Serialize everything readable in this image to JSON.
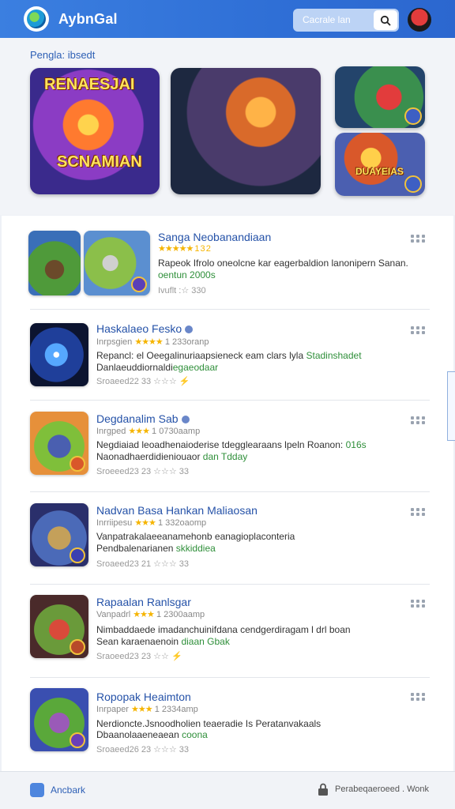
{
  "header": {
    "app_title": "AybnGal",
    "search_placeholder": "Cacrale lan",
    "logo_icon": "globe-logo-icon",
    "search_icon": "search-icon",
    "avatar_icon": "avatar-icon"
  },
  "featured": {
    "title": "Pengla: ibsedt",
    "tiles": [
      {
        "text_top": "RENAESJAI",
        "text_bottom": "SCNAMIAN"
      },
      {
        "text_top": "",
        "text_bottom": ""
      },
      {
        "text_top": "",
        "text_bottom": ""
      },
      {
        "text_top": "",
        "text_bottom": "DUAYEIAS"
      }
    ]
  },
  "items": [
    {
      "title": "Sanga Neobanandiaan",
      "meta": "★★★★★  1 3 2",
      "desc_1": "Rapeok Ifrolo oneolcne kar eagerbaldion lanonipern Sanan.",
      "desc_2": "oentun 2000s",
      "foot": "Ivuflt :☆ 330"
    },
    {
      "title": "Haskalaeo Fesko",
      "meta_prefix": "Inrpsgien",
      "meta_stars": "★★★★",
      "meta_suffix": "1 233oranp",
      "desc_1": "Repancl: el Oeegalinuriaapsieneck eam clars lyla",
      "desc_1_hl": "Stadinshadet",
      "desc_2": "Danlaeuddiornaldi",
      "desc_2_hl": "egaeodaar",
      "foot": "Sroaeed22 33  ☆☆☆ ⚡"
    },
    {
      "title": "Degdanalim Sab",
      "meta_prefix": "Inrgped",
      "meta_stars": "★★★",
      "meta_suffix": "1 0730aamp",
      "desc_1": "Negdiaiad leoadhenaioderise tdegglearaans lpeln Roanon:",
      "desc_1_hl": "016s",
      "desc_2": "Naonadhaerdidieniouaor",
      "desc_2_hl": "dan Tdday",
      "foot": "Sroeeed23 23  ☆☆☆ 33"
    },
    {
      "title": "Nadvan Basa Hankan Maliaosan",
      "meta_prefix": "Inrriipesu",
      "meta_stars": "★★★",
      "meta_suffix": "1 332oaomp",
      "desc_1": "Vanpatrakalaeeanamehonb eanagioplaconteria",
      "desc_1_hl": "",
      "desc_2": "Pendbalenarianen",
      "desc_2_hl": "skkiddiea",
      "foot": "Sroaeed23 21  ☆☆☆ 33"
    },
    {
      "title": "Rapaalan Ranlsgar",
      "meta_prefix": "Vanpadrl",
      "meta_stars": "★★★",
      "meta_suffix": "1 2300aamp",
      "desc_1": "Nimbaddaede imadanchuinifdana cendgerdiragam l drl boan",
      "desc_1_hl": "",
      "desc_2": "Sean karaenaenoin",
      "desc_2_hl": "diaan Gbak",
      "foot": "Sraoeed23 23  ☆☆ ⚡"
    },
    {
      "title": "Ropopak Heaimton",
      "meta_prefix": "Inrpaper",
      "meta_stars": "★★★",
      "meta_suffix": "1 2334amp",
      "desc_1": "Nerdioncte.Jsnoodholien teaeradie Is Peratanvakaals",
      "desc_1_hl": "",
      "desc_2": "Dbaanolaaeneaean",
      "desc_2_hl": "coona",
      "foot": "Sroaeed26 23  ☆☆☆ 33"
    }
  ],
  "bottom": {
    "left_label": "Ancbark",
    "right_label": "Perabeqaeroeed . Wonk",
    "left_icon": "home-icon",
    "right_icon": "lock-icon"
  },
  "colors": {
    "header": "#2f6fd6",
    "accent": "#2552a8",
    "star": "#f5b400",
    "highlight": "#2f8f3a"
  }
}
